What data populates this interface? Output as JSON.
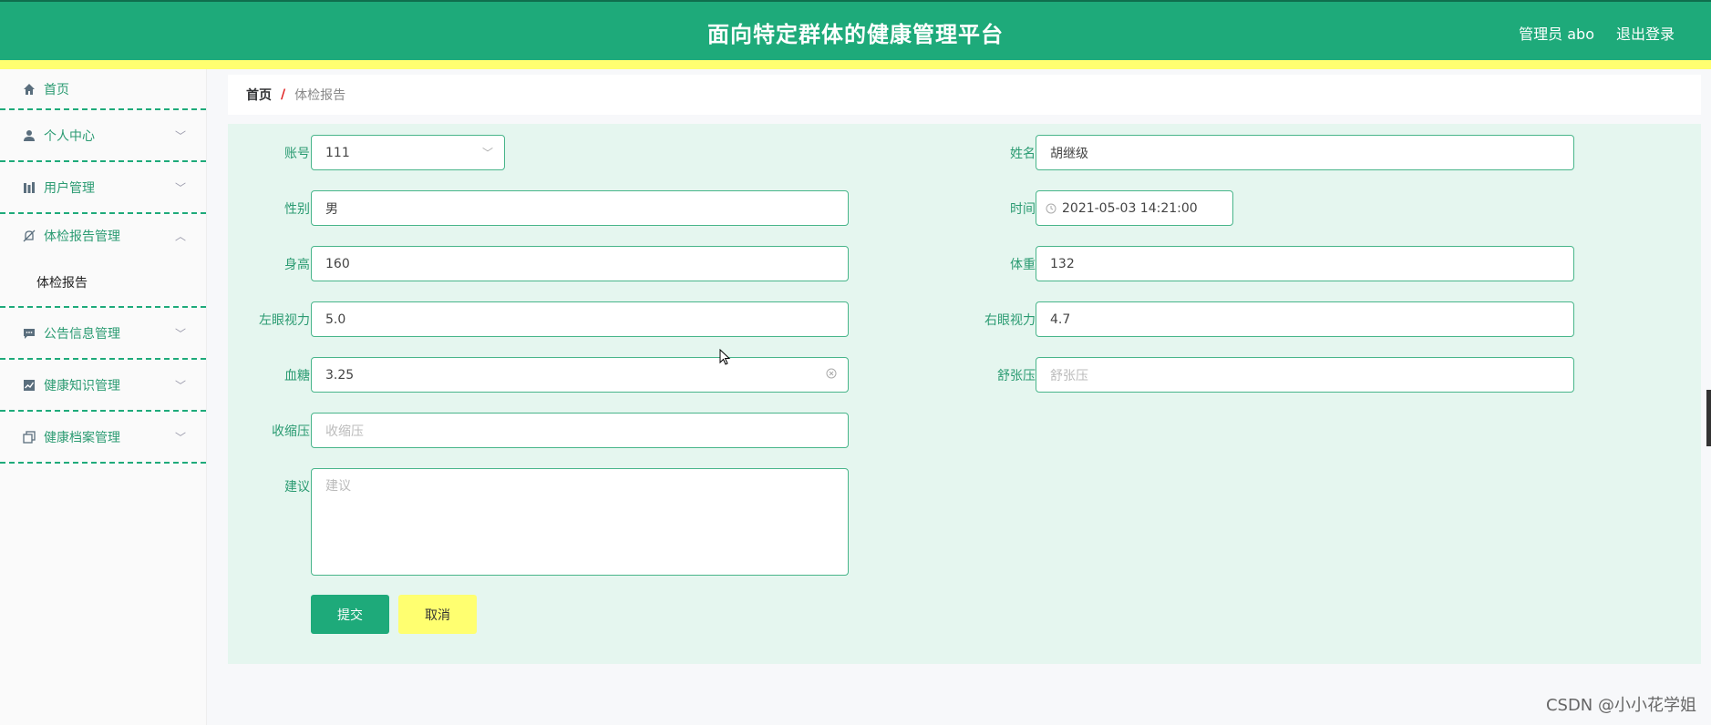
{
  "header": {
    "title": "面向特定群体的健康管理平台",
    "user_label": "管理员 abo",
    "logout_label": "退出登录"
  },
  "sidebar": {
    "items": [
      {
        "label": "首页",
        "icon": "home-icon"
      },
      {
        "label": "个人中心",
        "icon": "user-icon"
      },
      {
        "label": "用户管理",
        "icon": "chart-icon"
      },
      {
        "label": "体检报告管理",
        "icon": "bell-off-icon"
      },
      {
        "label": "公告信息管理",
        "icon": "message-icon"
      },
      {
        "label": "健康知识管理",
        "icon": "trend-icon"
      },
      {
        "label": "健康档案管理",
        "icon": "copy-icon"
      }
    ],
    "subitem": "体检报告"
  },
  "breadcrumb": {
    "home": "首页",
    "separator": "/",
    "current": "体检报告"
  },
  "form": {
    "account": {
      "label": "账号",
      "value": "111"
    },
    "name": {
      "label": "姓名",
      "value": "胡继级"
    },
    "gender": {
      "label": "性别",
      "value": "男"
    },
    "time": {
      "label": "时间",
      "value": "2021-05-03 14:21:00"
    },
    "height": {
      "label": "身高",
      "value": "160"
    },
    "weight": {
      "label": "体重",
      "value": "132"
    },
    "left_eye": {
      "label": "左眼视力",
      "value": "5.0"
    },
    "right_eye": {
      "label": "右眼视力",
      "value": "4.7"
    },
    "blood_sugar": {
      "label": "血糖",
      "value": "3.25"
    },
    "diastolic": {
      "label": "舒张压",
      "placeholder": "舒张压"
    },
    "systolic": {
      "label": "收缩压",
      "placeholder": "收缩压"
    },
    "advice": {
      "label": "建议",
      "placeholder": "建议"
    },
    "submit_label": "提交",
    "cancel_label": "取消"
  },
  "watermark": "CSDN @小小花学姐",
  "colors": {
    "primary": "#1eaa7a",
    "accent": "#ffff70",
    "panel": "#e5f6ef"
  }
}
